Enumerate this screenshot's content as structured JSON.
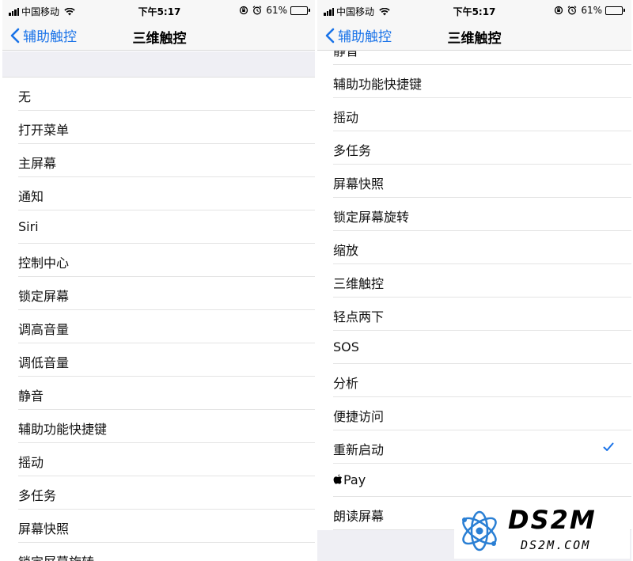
{
  "status_bar": {
    "carrier": "中国移动",
    "time": "下午5:17",
    "battery": "61%",
    "battery_level": 0.61
  },
  "nav": {
    "back_label": "辅助触控",
    "title": "三维触控"
  },
  "left_list": [
    {
      "label": "无"
    },
    {
      "label": "打开菜单"
    },
    {
      "label": "主屏幕"
    },
    {
      "label": "通知"
    },
    {
      "label": "Siri"
    },
    {
      "label": "控制中心"
    },
    {
      "label": "锁定屏幕"
    },
    {
      "label": "调高音量"
    },
    {
      "label": "调低音量"
    },
    {
      "label": "静音"
    },
    {
      "label": "辅助功能快捷键"
    },
    {
      "label": "摇动"
    },
    {
      "label": "多任务"
    },
    {
      "label": "屏幕快照"
    },
    {
      "label": "锁定屏幕旋转"
    }
  ],
  "right_list": [
    {
      "label": "静音"
    },
    {
      "label": "辅助功能快捷键"
    },
    {
      "label": "摇动"
    },
    {
      "label": "多任务"
    },
    {
      "label": "屏幕快照"
    },
    {
      "label": "锁定屏幕旋转"
    },
    {
      "label": "缩放"
    },
    {
      "label": "三维触控"
    },
    {
      "label": "轻点两下"
    },
    {
      "label": "SOS"
    },
    {
      "label": "分析"
    },
    {
      "label": "便捷访问"
    },
    {
      "label": "重新启动",
      "selected": true
    },
    {
      "label": "Pay",
      "icon": "apple-icon"
    },
    {
      "label": "朗读屏幕"
    }
  ],
  "colors": {
    "accent": "#1a73e8",
    "separator": "#e4e4e4",
    "group_bg": "#efeff4"
  },
  "watermark": {
    "title": "DS2M",
    "subtitle": "DS2M.COM"
  }
}
